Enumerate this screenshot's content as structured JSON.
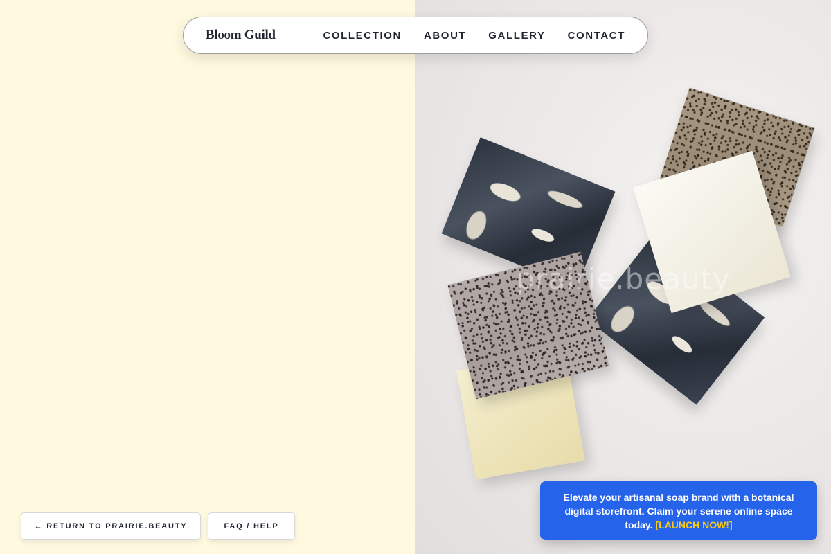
{
  "nav": {
    "brand": "Bloom Guild",
    "links": [
      "COLLECTION",
      "ABOUT",
      "GALLERY",
      "CONTACT"
    ]
  },
  "hero": {
    "watermark": "prairie.beauty"
  },
  "footer": {
    "return_label": "← RETURN TO PRAIRIE.BEAUTY",
    "faq_label": "FAQ / HELP"
  },
  "promo": {
    "text": "Elevate your artisanal soap brand with a botanical digital storefront. Claim your serene online space today. ",
    "cta": "[LAUNCH NOW!]"
  },
  "colors": {
    "left_panel": "#fff9e0",
    "promo_bg": "#2563eb",
    "promo_cta": "#facc15",
    "text": "#1f2430"
  }
}
